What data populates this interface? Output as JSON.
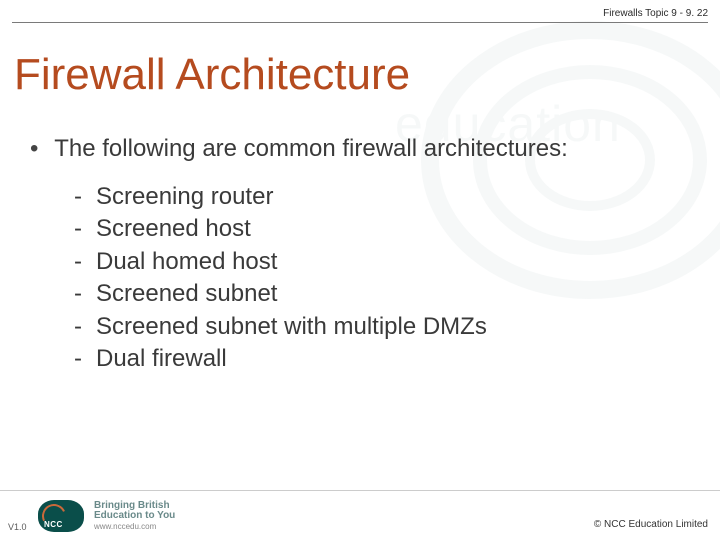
{
  "header": {
    "topic_label": "Firewalls  Topic 9 - 9. 22"
  },
  "title": "Firewall Architecture",
  "intro": {
    "bullet": "•",
    "text": "The following are common firewall architectures:"
  },
  "items": [
    "Screening router",
    "Screened host",
    "Dual homed host",
    "Screened subnet",
    "Screened subnet with multiple DMZs",
    "Dual firewall"
  ],
  "dash": "-",
  "footer": {
    "version": "V1.0",
    "logo_text": "NCC",
    "tagline1": "Bringing British",
    "tagline2": "Education to You",
    "url": "www.nccedu.com",
    "copyright": "©   NCC Education Limited"
  },
  "watermark_text": "education"
}
